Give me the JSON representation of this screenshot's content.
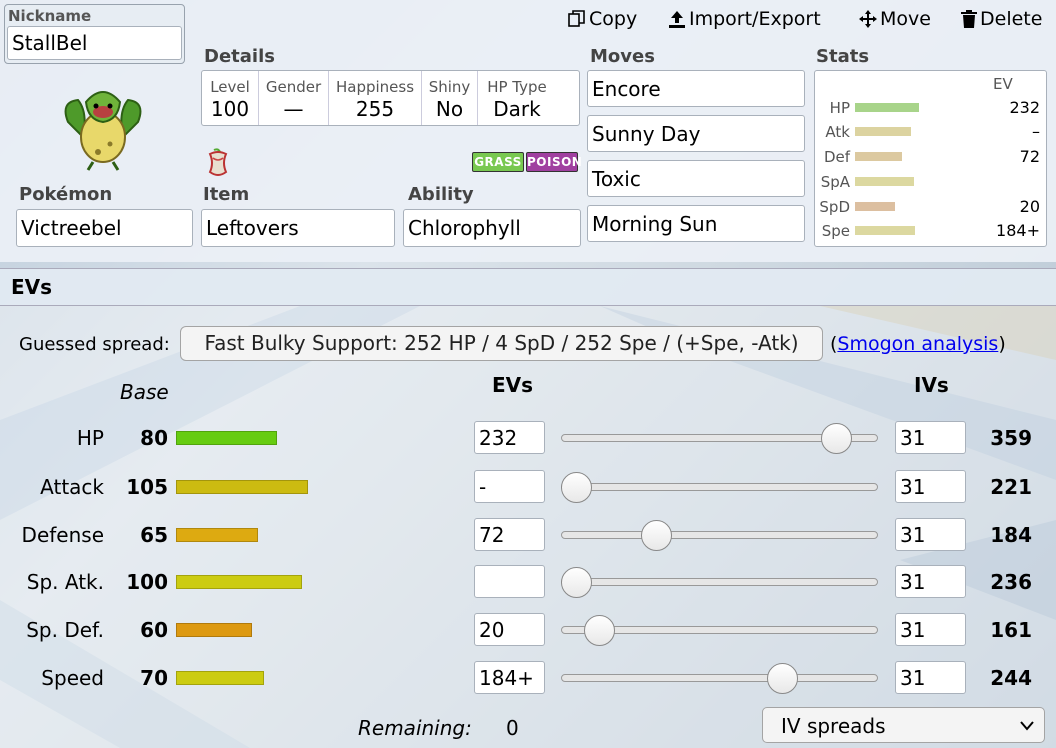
{
  "nickname": {
    "label": "Nickname",
    "value": "StallBel"
  },
  "toolbar": {
    "copy": "Copy",
    "import_export": "Import/Export",
    "move": "Move",
    "delete": "Delete"
  },
  "details": {
    "section_label": "Details",
    "level": {
      "label": "Level",
      "value": "100"
    },
    "gender": {
      "label": "Gender",
      "value": "—"
    },
    "happiness": {
      "label": "Happiness",
      "value": "255"
    },
    "shiny": {
      "label": "Shiny",
      "value": "No"
    },
    "hp_type": {
      "label": "HP Type",
      "value": "Dark"
    }
  },
  "types": [
    "GRASS",
    "POISON"
  ],
  "pokemon": {
    "label": "Pokémon",
    "value": "Victreebel"
  },
  "item": {
    "label": "Item",
    "value": "Leftovers"
  },
  "ability": {
    "label": "Ability",
    "value": "Chlorophyll"
  },
  "moves": {
    "label": "Moves",
    "items": [
      "Encore",
      "Sunny Day",
      "Toxic",
      "Morning Sun"
    ]
  },
  "stats_panel": {
    "label": "Stats",
    "ev_header": "EV",
    "rows": [
      {
        "name": "HP",
        "ev": "232",
        "fill": 0.41
      },
      {
        "name": "Atk",
        "ev": "–",
        "fill": 0.36
      },
      {
        "name": "Def",
        "ev": "72",
        "fill": 0.3
      },
      {
        "name": "SpA",
        "ev": "",
        "fill": 0.38
      },
      {
        "name": "SpD",
        "ev": "20",
        "fill": 0.26
      },
      {
        "name": "Spe",
        "ev": "184+",
        "fill": 0.39
      }
    ]
  },
  "evs_section": {
    "title": "EVs",
    "guessed_label": "Guessed spread:",
    "guessed_value": "Fast Bulky Support: 252 HP / 4 SpD / 252 Spe / (+Spe, -Atk)",
    "smogon_open": "(",
    "smogon_link": "Smogon analysis",
    "smogon_close": ")",
    "col_base": "Base",
    "col_evs": "EVs",
    "col_ivs": "IVs",
    "rows": [
      {
        "name": "HP",
        "base": "80",
        "ev": "232",
        "iv": "31",
        "total": "359",
        "ev_fraction": 0.91,
        "color": "#66cc11"
      },
      {
        "name": "Attack",
        "base": "105",
        "ev": "-",
        "iv": "31",
        "total": "221",
        "ev_fraction": 0.0,
        "color": "#ccbb11"
      },
      {
        "name": "Defense",
        "base": "65",
        "ev": "72",
        "iv": "31",
        "total": "184",
        "ev_fraction": 0.28,
        "color": "#ddaa11"
      },
      {
        "name": "Sp. Atk.",
        "base": "100",
        "ev": "",
        "iv": "31",
        "total": "236",
        "ev_fraction": 0.0,
        "color": "#cccc11"
      },
      {
        "name": "Sp. Def.",
        "base": "60",
        "ev": "20",
        "iv": "31",
        "total": "161",
        "ev_fraction": 0.08,
        "color": "#dd9911"
      },
      {
        "name": "Speed",
        "base": "70",
        "ev": "184+",
        "iv": "31",
        "total": "244",
        "ev_fraction": 0.72,
        "color": "#cccc11"
      }
    ],
    "remaining_label": "Remaining:",
    "remaining_value": "0",
    "iv_select": "IV spreads"
  },
  "colors": {
    "grass": "#78c850",
    "poison": "#a040a0",
    "link": "#0000ee"
  }
}
